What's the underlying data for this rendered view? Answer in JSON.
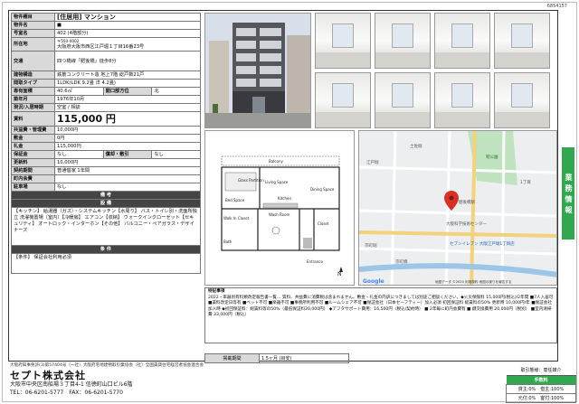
{
  "doc_id": "6854157",
  "spec": {
    "rows": [
      {
        "k": "物件種目",
        "v": "[住居用] マンション"
      },
      {
        "k": "物件名",
        "v": "■"
      },
      {
        "k": "号室名",
        "v": "402 (4階部分)"
      },
      {
        "k": "所在地",
        "v": "〒550-0002",
        "v2": "大阪府大阪市西区江戸堀１丁目16番23号"
      },
      {
        "k": "交通",
        "v": "四つ橋線「肥後橋」徒歩8分"
      },
      {
        "k": "建物構造",
        "v": "鉄筋コンクリート造 地上7階 総戸数21戸"
      },
      {
        "k": "間取タイプ",
        "v": "1LDK(LDK 9.2畳 洋 4.2畳)"
      },
      {
        "k": "専有面積",
        "v": "40.6㎡",
        "k2": "開口部方位",
        "v2": "北"
      },
      {
        "k": "築年月",
        "v": "1976年10月"
      },
      {
        "k": "現況/入居時期",
        "v": "空室 / 相談"
      }
    ],
    "rent_label": "賃料",
    "rent": "115,000 円",
    "rows2": [
      {
        "k": "共益費・管理費",
        "v": "10,000円"
      },
      {
        "k": "敷金",
        "v": "0円"
      },
      {
        "k": "礼金",
        "v": "115,000円"
      },
      {
        "k": "保証金",
        "v": "なし",
        "k2": "償却・敷引",
        "v2": "なし"
      },
      {
        "k": "更新料",
        "v": "10,000円"
      },
      {
        "k": "契約期間",
        "v": "普通借家 1年間"
      },
      {
        "k": "町内会費",
        "v": ""
      },
      {
        "k": "駐車場",
        "v": "なし"
      }
    ],
    "notes_header": "備 考",
    "equip_header": "設 備",
    "equip_text": "【キッチン】 給湯器（ガス）・システムキッチン【水周り】 バス・トイレ別・洗面所独立 洗濯機置場（室内）【冷暖房】 エアコン【収納】 ウォークインクローゼット【セキュリティ】 オートロック・インターホン【その他】 バルコニー・ペアガラス・デザイナーズ",
    "cond_header": "条 件",
    "cond_text": "【条件】 保証会社利用必須"
  },
  "floorplan": {
    "labels": [
      "Bed Space",
      "Glass Partition",
      "Living Space",
      "Dining Space",
      "Kitchen",
      "Balcony",
      "Walk In Closet",
      "Wash Room",
      "Bath",
      "Closet"
    ],
    "entrance": "Entrance",
    "north": "N"
  },
  "map": {
    "labels": [
      "江戸堀",
      "土佐堀",
      "靭公園",
      "京町堀",
      "肥後橋駅",
      "大阪科学技術センター",
      "セブンイレブン 大阪江戸堀1丁目店",
      "京町橋",
      "1丁目"
    ],
    "brand": "Google",
    "footer": "地図データ ©2020 利用規約 地図の誤りを報告する"
  },
  "remarks": {
    "title": "特記事項",
    "body": "2022・率器別有料類改定報告書一覧… 質料、共益費に消費税は含まれません。敷金・礼金の内訳につきましては別途ご相談ください。◆火災保険料 15,000円(税込)/2年間 ■7人入居可 ■賃料改定日等有 ■ペット不可 ■楽器不可 ■事務所利用不可 ■ルームシェア不可 ■保証会社（日本セーフティー）加入必須 初回保証料 総賃料の50% 更新時 10,000円/年 ■保証会社加入時 ◆初回保証料：総賃料等の50%（最低保証料20,000円） ◆アフタサポート費用：16,500円（税込/契約時） ■ 2年毎に町内会費有 ■ 鍵交換費用 20,000円（税別） ■室内清掃費 33,000円（税込）"
  },
  "period": {
    "k": "掲載期間",
    "v": "1.5ヶ月 (目安)"
  },
  "sidetab": "業務情報",
  "footer": {
    "license": "大阪府知事免許(3)第57404号（一社）大阪府宅地建物取引業協会（社）全国賃貸住宅経営者協会連合会",
    "company": "セプト株式会社",
    "addr": "大阪市中央区南船場３丁目4-1 信徳町山口ビル6階",
    "tel": "TEL：06-6201-5777　FAX：06-6201-5770"
  },
  "transaction": {
    "header": "取引態様：専任媒介",
    "fee_label": "手数料",
    "row1": "貸主:0%　借主:100%",
    "row2": "元付:0%　客付:100%"
  },
  "colors": {
    "green": "#2fa84f",
    "header": "#444444",
    "label_bg": "#d9d9d9"
  }
}
